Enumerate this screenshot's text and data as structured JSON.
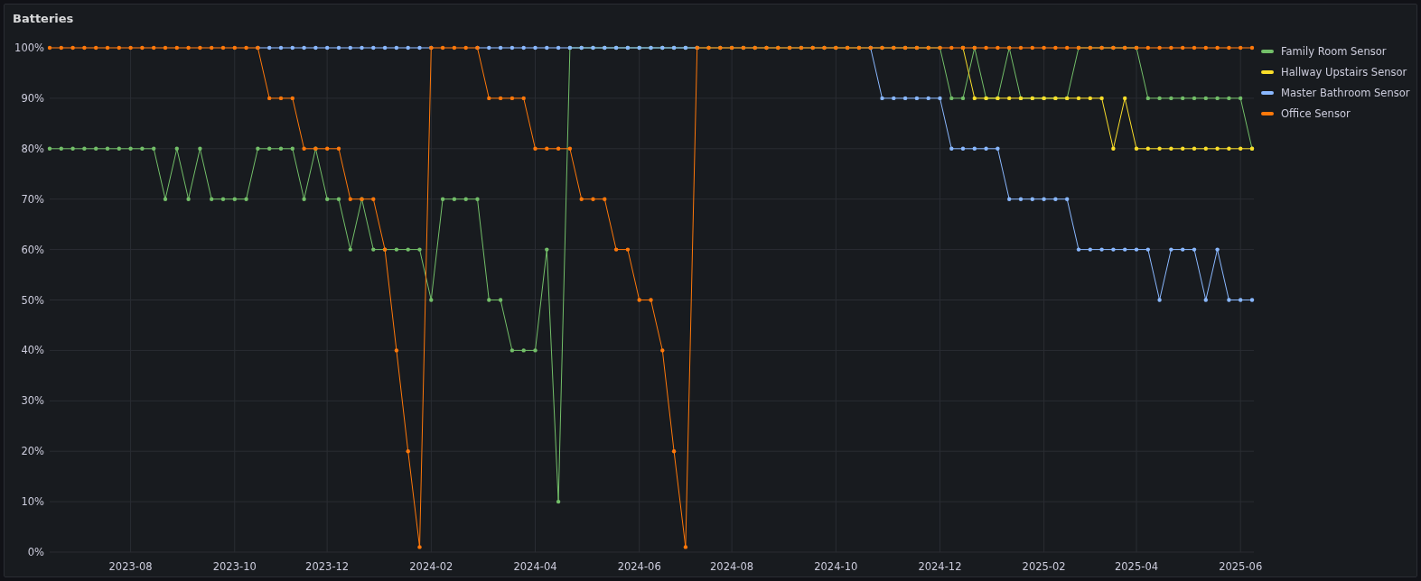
{
  "panel": {
    "title": "Batteries",
    "chart_data": {
      "type": "line",
      "grid": true,
      "categories": [
        null,
        null,
        null,
        null,
        null,
        null,
        null,
        "2023-08",
        null,
        null,
        null,
        null,
        null,
        null,
        null,
        null,
        "2023-10",
        null,
        null,
        null,
        null,
        null,
        null,
        null,
        "2023-12",
        null,
        null,
        null,
        null,
        null,
        null,
        null,
        null,
        "2024-02",
        null,
        null,
        null,
        null,
        null,
        null,
        null,
        null,
        "2024-04",
        null,
        null,
        null,
        null,
        null,
        null,
        null,
        null,
        "2024-06",
        null,
        null,
        null,
        null,
        null,
        null,
        null,
        "2024-08",
        null,
        null,
        null,
        null,
        null,
        null,
        null,
        null,
        "2024-10",
        null,
        null,
        null,
        null,
        null,
        null,
        null,
        null,
        "2024-12",
        null,
        null,
        null,
        null,
        null,
        null,
        null,
        null,
        "2025-02",
        null,
        null,
        null,
        null,
        null,
        null,
        null,
        "2025-04",
        null,
        null,
        null,
        null,
        null,
        null,
        null,
        null,
        "2025-06",
        null
      ],
      "ylim": [
        0,
        100
      ],
      "yticks": [
        {
          "value": 0,
          "label": "0%"
        },
        {
          "value": 10,
          "label": "10%"
        },
        {
          "value": 20,
          "label": "20%"
        },
        {
          "value": 30,
          "label": "30%"
        },
        {
          "value": 40,
          "label": "40%"
        },
        {
          "value": 50,
          "label": "50%"
        },
        {
          "value": 60,
          "label": "60%"
        },
        {
          "value": 70,
          "label": "70%"
        },
        {
          "value": 80,
          "label": "80%"
        },
        {
          "value": 90,
          "label": "90%"
        },
        {
          "value": 100,
          "label": "100%"
        }
      ],
      "series": [
        {
          "name": "Family Room Sensor",
          "color": "#73bf69",
          "values": [
            80,
            80,
            80,
            80,
            80,
            80,
            80,
            80,
            80,
            80,
            70,
            80,
            70,
            80,
            70,
            70,
            70,
            70,
            80,
            80,
            80,
            80,
            70,
            80,
            70,
            70,
            60,
            70,
            60,
            60,
            60,
            60,
            60,
            50,
            70,
            70,
            70,
            70,
            50,
            50,
            40,
            40,
            40,
            60,
            10,
            100,
            100,
            100,
            100,
            100,
            100,
            100,
            100,
            100,
            100,
            100,
            100,
            100,
            100,
            100,
            100,
            100,
            100,
            100,
            100,
            100,
            100,
            100,
            100,
            100,
            100,
            100,
            100,
            100,
            100,
            100,
            100,
            100,
            90,
            90,
            100,
            90,
            90,
            100,
            90,
            90,
            90,
            90,
            90,
            100,
            100,
            100,
            100,
            100,
            100,
            90,
            90,
            90,
            90,
            90,
            90,
            90,
            90,
            90,
            80
          ]
        },
        {
          "name": "Hallway Upstairs Sensor",
          "color": "#fade2a",
          "values": [
            null,
            null,
            null,
            null,
            null,
            null,
            null,
            null,
            null,
            null,
            null,
            null,
            null,
            null,
            null,
            null,
            null,
            null,
            null,
            null,
            null,
            null,
            null,
            null,
            null,
            null,
            null,
            null,
            null,
            null,
            null,
            null,
            null,
            null,
            null,
            null,
            null,
            null,
            null,
            null,
            null,
            null,
            null,
            null,
            null,
            null,
            null,
            null,
            null,
            null,
            null,
            null,
            null,
            null,
            null,
            null,
            null,
            null,
            null,
            null,
            null,
            null,
            null,
            null,
            null,
            null,
            null,
            null,
            null,
            null,
            null,
            null,
            null,
            null,
            null,
            null,
            null,
            null,
            null,
            100,
            90,
            90,
            90,
            90,
            90,
            90,
            90,
            90,
            90,
            90,
            90,
            90,
            80,
            90,
            80,
            80,
            80,
            80,
            80,
            80,
            80,
            80,
            80,
            80,
            80
          ]
        },
        {
          "name": "Master Bathroom Sensor",
          "color": "#8ab8ff",
          "values": [
            null,
            null,
            null,
            null,
            null,
            null,
            null,
            null,
            null,
            null,
            null,
            null,
            null,
            null,
            null,
            null,
            null,
            null,
            100,
            100,
            100,
            100,
            100,
            100,
            100,
            100,
            100,
            100,
            100,
            100,
            100,
            100,
            100,
            100,
            null,
            null,
            null,
            100,
            100,
            100,
            100,
            100,
            100,
            100,
            100,
            100,
            100,
            100,
            100,
            100,
            100,
            100,
            100,
            100,
            100,
            100,
            100,
            null,
            null,
            null,
            null,
            null,
            null,
            null,
            null,
            null,
            null,
            null,
            null,
            null,
            null,
            100,
            90,
            90,
            90,
            90,
            90,
            90,
            80,
            80,
            80,
            80,
            80,
            70,
            70,
            70,
            70,
            70,
            70,
            60,
            60,
            60,
            60,
            60,
            60,
            60,
            50,
            60,
            60,
            60,
            50,
            60,
            50,
            50,
            50
          ]
        },
        {
          "name": "Office Sensor",
          "color": "#ff780a",
          "values": [
            100,
            100,
            100,
            100,
            100,
            100,
            100,
            100,
            100,
            100,
            100,
            100,
            100,
            100,
            100,
            100,
            100,
            100,
            100,
            90,
            90,
            90,
            80,
            80,
            80,
            80,
            70,
            70,
            70,
            60,
            40,
            20,
            1,
            100,
            100,
            100,
            100,
            100,
            90,
            90,
            90,
            90,
            80,
            80,
            80,
            80,
            70,
            70,
            70,
            60,
            60,
            50,
            50,
            40,
            20,
            1,
            100,
            100,
            100,
            100,
            100,
            100,
            100,
            100,
            100,
            100,
            100,
            100,
            100,
            100,
            100,
            100,
            100,
            100,
            100,
            100,
            100,
            100,
            100,
            100,
            100,
            100,
            100,
            100,
            100,
            100,
            100,
            100,
            100,
            100,
            100,
            100,
            100,
            100,
            100,
            100,
            100,
            100,
            100,
            100,
            100,
            100,
            100,
            100,
            100
          ]
        }
      ]
    }
  }
}
